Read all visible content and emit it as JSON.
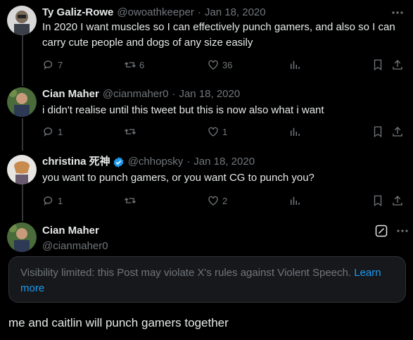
{
  "tweets": [
    {
      "name": "Ty Galiz-Rowe",
      "handle": "@owoathkeeper",
      "sep": "·",
      "date": "Jan 18, 2020",
      "text": "In 2020 I want muscles so I can effectively punch gamers, and also so I can carry cute people and dogs of any size easily",
      "replies": "7",
      "retweets": "6",
      "likes": "36"
    },
    {
      "name": "Cian Maher",
      "handle": "@cianmaher0",
      "sep": "·",
      "date": "Jan 18, 2020",
      "text": "i didn't realise until this tweet but this is now also what i want",
      "replies": "1",
      "retweets": "",
      "likes": "1"
    },
    {
      "name": "christina 死神",
      "handle": "@chhopsky",
      "sep": "·",
      "date": "Jan 18, 2020",
      "text": "you want to punch gamers, or you want CG to punch you?",
      "replies": "1",
      "retweets": "",
      "likes": "2",
      "verified": true
    }
  ],
  "focal": {
    "name": "Cian Maher",
    "handle": "@cianmaher0",
    "notice": "Visibility limited: this Post may violate X's rules against Violent Speech.",
    "notice_link": "Learn more",
    "text": "me and caitlin will punch gamers together"
  },
  "colors": {
    "accent": "#1d9bf0",
    "muted": "#71767b",
    "text": "#e7e9ea",
    "bg": "#000000"
  }
}
